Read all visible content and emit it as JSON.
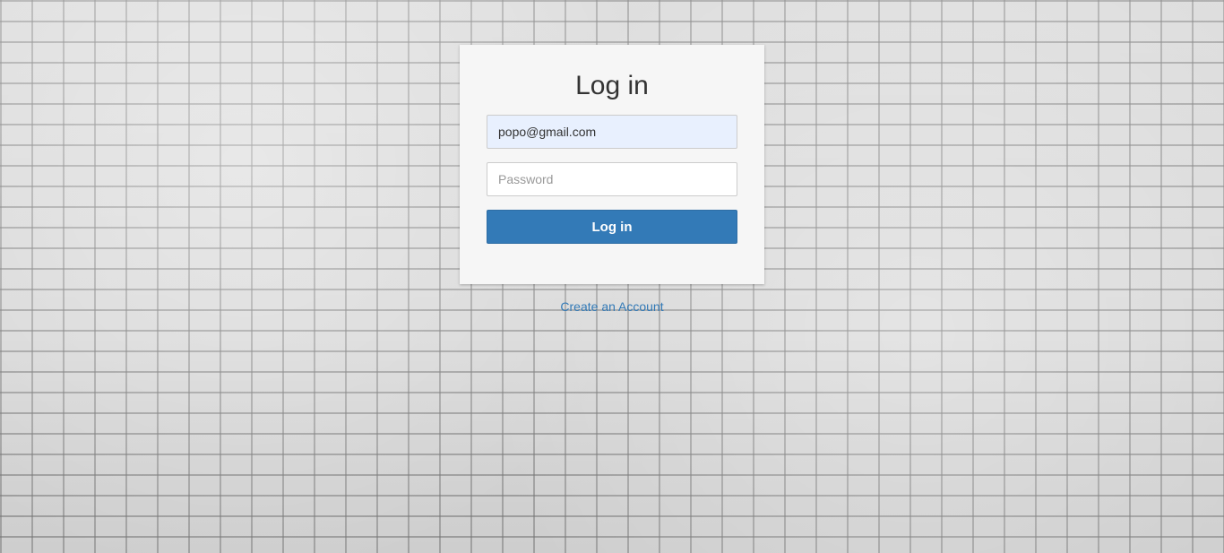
{
  "colors": {
    "primary": "#337ab7",
    "card_background": "#f6f6f6",
    "autofill_background": "#e8f0fe"
  },
  "login": {
    "title": "Log in",
    "email_value": "popo@gmail.com",
    "password_placeholder": "Password",
    "submit_label": "Log in"
  },
  "links": {
    "create_account": "Create an Account"
  }
}
